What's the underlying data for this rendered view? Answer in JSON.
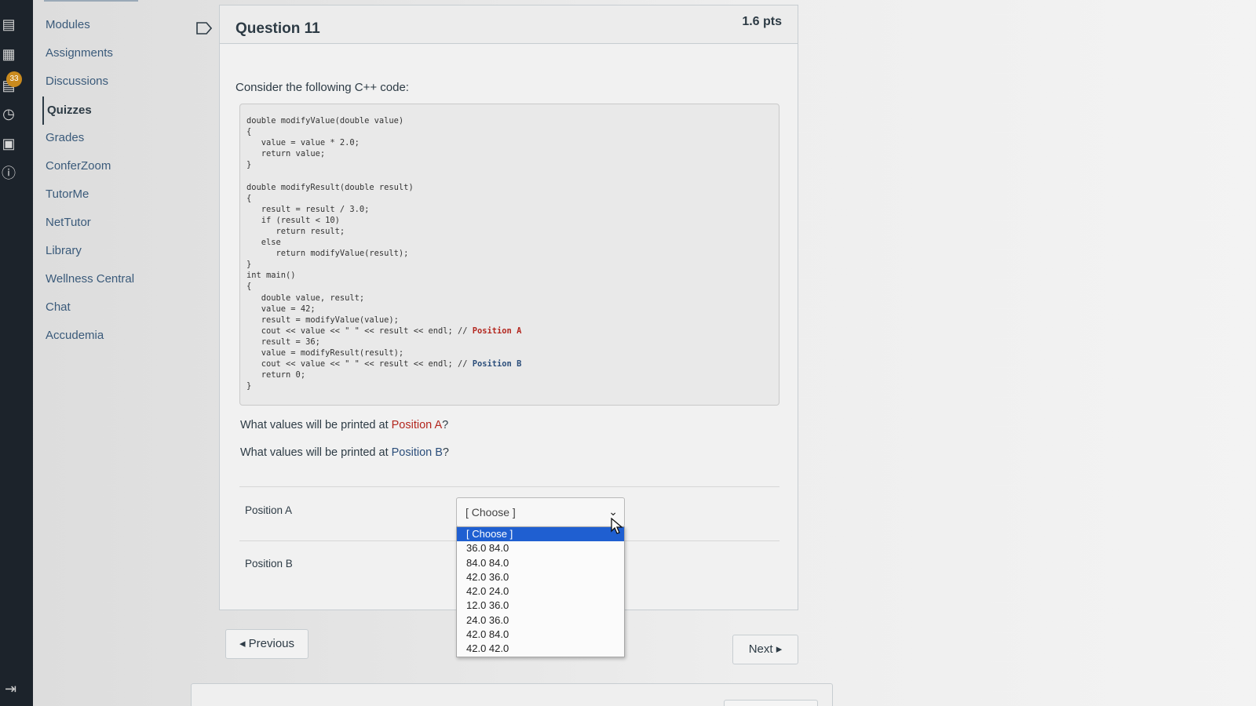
{
  "global_nav": {
    "badge_count": "33",
    "icons": [
      "inbox-icon",
      "calendar-icon",
      "inbox-badge-icon",
      "history-icon",
      "commons-icon",
      "help-icon",
      "collapse-icon"
    ]
  },
  "course_nav": {
    "items": [
      "Modules",
      "Assignments",
      "Discussions",
      "Quizzes",
      "Grades",
      "ConferZoom",
      "TutorMe",
      "NetTutor",
      "Library",
      "Wellness Central",
      "Chat",
      "Accudemia"
    ],
    "active": "Quizzes"
  },
  "question": {
    "title": "Question 11",
    "points": "1.6 pts",
    "intro": "Consider the following C++ code:",
    "code_part1": "double modifyValue(double value)\n{\n   value = value * 2.0;\n   return value;\n}\n\ndouble modifyResult(double result)\n{\n   result = result / 3.0;\n   if (result < 10)\n      return result;\n   else\n      return modifyValue(result);\n}\nint main()\n{\n   double value, result;\n   value = 42;\n   result = modifyValue(value);\n   cout << value << \" \" << result << endl; // ",
    "code_label_a": "Position A",
    "code_part2": "\n   result = 36;\n   value = modifyResult(result);\n   cout << value << \" \" << result << endl; // ",
    "code_label_b": "Position B",
    "code_part3": "\n   return 0;\n}",
    "ask_a_prefix": "What values will be printed at ",
    "ask_a_highlight": "Position A",
    "ask_a_suffix": "?",
    "ask_b_prefix": "What values will be printed at ",
    "ask_b_highlight": "Position B",
    "ask_b_suffix": "?",
    "row_a_label": "Position A",
    "row_b_label": "Position B",
    "select_value": "[ Choose ]",
    "options": [
      "[ Choose ]",
      "36.0 84.0",
      "84.0 84.0",
      "42.0 36.0",
      "42.0 24.0",
      "12.0 36.0",
      "24.0 36.0",
      "42.0 84.0",
      "42.0 42.0"
    ],
    "selected_option": "[ Choose ]"
  },
  "nav_buttons": {
    "previous": "◂ Previous",
    "next": "Next ▸"
  },
  "colors": {
    "selected_option": "#1f5fd1",
    "position_a_highlight": "#b3261e",
    "position_b_highlight": "#2a4d7a",
    "badge": "#c98a1e"
  }
}
